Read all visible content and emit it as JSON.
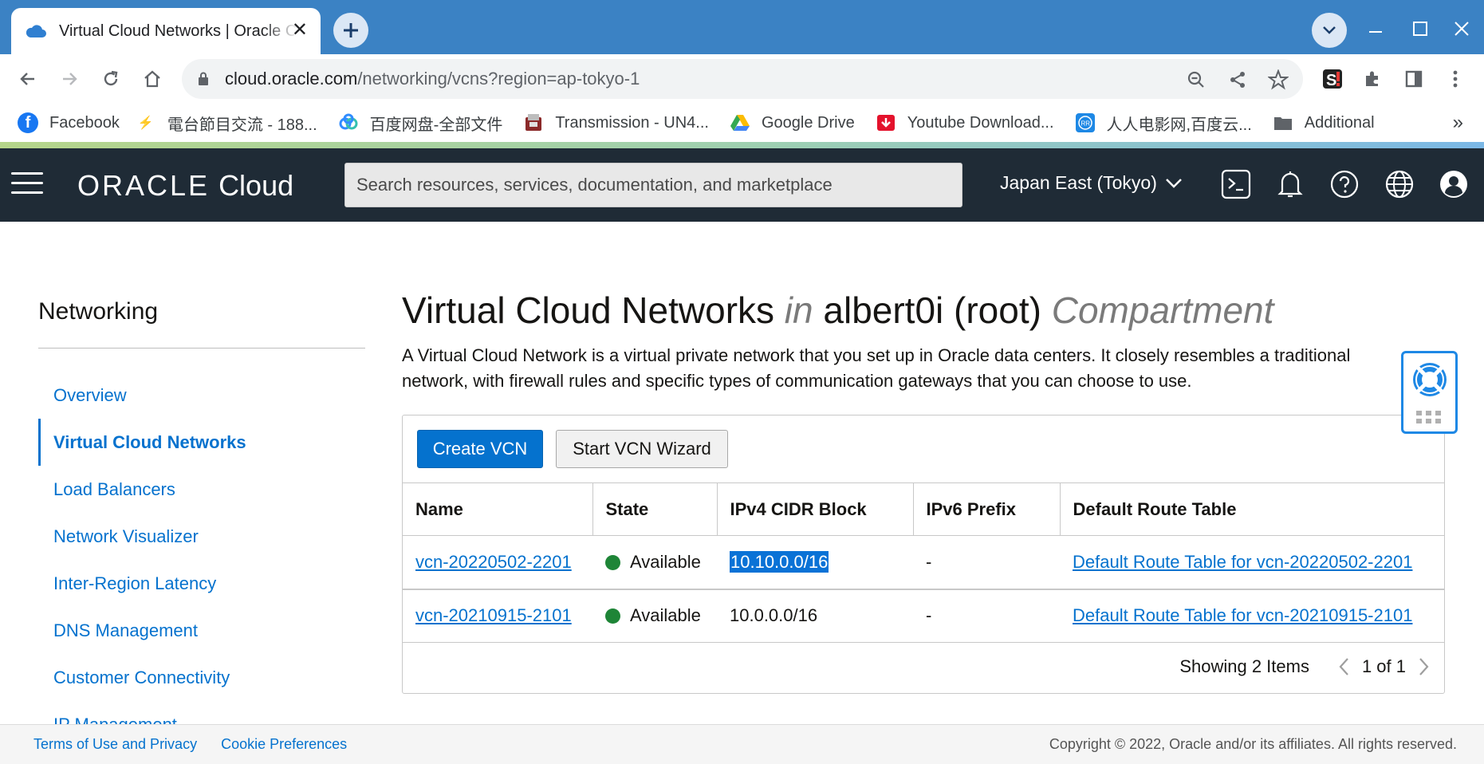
{
  "browser": {
    "tab_title": "Virtual Cloud Networks | Oracle Cloud Infrastructure",
    "url_host": "cloud.oracle.com",
    "url_path": "/networking/vcns?region=ap-tokyo-1",
    "bookmarks": [
      {
        "label": "Facebook",
        "icon": "facebook-icon",
        "color": "#1877f2"
      },
      {
        "label": "電台節目交流 - 188...",
        "icon": "lightning-icon",
        "color": "#f5c518"
      },
      {
        "label": "百度网盘-全部文件",
        "icon": "baidu-cloud-icon",
        "color": "#2f8cff"
      },
      {
        "label": "Transmission - UN4...",
        "icon": "transmission-icon",
        "color": "#8b2a2a"
      },
      {
        "label": "Google Drive",
        "icon": "google-drive-icon",
        "color": "#34a853"
      },
      {
        "label": "Youtube Download...",
        "icon": "download-icon",
        "color": "#e4122c"
      },
      {
        "label": "人人电影网,百度云...",
        "icon": "rr-icon",
        "color": "#1e88e5"
      },
      {
        "label": "Additional",
        "icon": "folder-icon",
        "color": "#5f6368"
      }
    ],
    "more_bookmarks": "»"
  },
  "header": {
    "logo_oracle": "ORACLE",
    "logo_cloud": "Cloud",
    "search_placeholder": "Search resources, services, documentation, and marketplace",
    "region": "Japan East (Tokyo)"
  },
  "sidebar": {
    "title": "Networking",
    "items": [
      {
        "label": "Overview",
        "active": false
      },
      {
        "label": "Virtual Cloud Networks",
        "active": true
      },
      {
        "label": "Load Balancers",
        "active": false
      },
      {
        "label": "Network Visualizer",
        "active": false
      },
      {
        "label": "Inter-Region Latency",
        "active": false
      },
      {
        "label": "DNS Management",
        "active": false
      },
      {
        "label": "Customer Connectivity",
        "active": false
      },
      {
        "label": "IP Management",
        "active": false
      }
    ]
  },
  "main": {
    "title_main": "Virtual Cloud Networks",
    "title_in": "in",
    "title_compartment_name": "albert0i (root)",
    "title_compartment_word": "Compartment",
    "description": "A Virtual Cloud Network is a virtual private network that you set up in Oracle data centers. It closely resembles a traditional network, with firewall rules and specific types of communication gateways that you can choose to use.",
    "create_button": "Create VCN",
    "wizard_button": "Start VCN Wizard",
    "columns": [
      "Name",
      "State",
      "IPv4 CIDR Block",
      "IPv6 Prefix",
      "Default Route Table"
    ],
    "rows": [
      {
        "name": "vcn-20220502-2201",
        "state": "Available",
        "ipv4": "10.10.0.0/16",
        "ipv6": "-",
        "route_table": "Default Route Table for vcn-20220502-2201"
      },
      {
        "name": "vcn-20210915-2101",
        "state": "Available",
        "ipv4": "10.0.0.0/16",
        "ipv6": "-",
        "route_table": "Default Route Table for vcn-20210915-2101"
      }
    ],
    "showing": "Showing 2 Items",
    "page": "1 of 1"
  },
  "footer": {
    "terms": "Terms of Use and Privacy",
    "cookies": "Cookie Preferences",
    "copyright": "Copyright © 2022, Oracle and/or its affiliates. All rights reserved."
  },
  "colors": {
    "tabstrip": "#3b82c4",
    "oci_header": "#1f2b36",
    "link": "#0572ce",
    "available": "#1e8537"
  }
}
